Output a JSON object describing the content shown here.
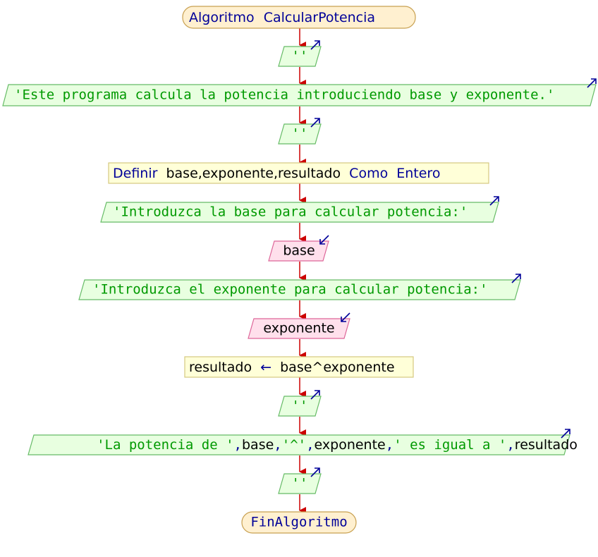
{
  "colors": {
    "arrow": "#cc0000",
    "keyword": "#000099",
    "string": "#009900",
    "text": "#000000",
    "terminal_fill": "#fff0d0",
    "terminal_stroke": "#c8a050",
    "output_fill": "#e8ffe0",
    "output_stroke": "#66bb66",
    "input_fill": "#ffe0ec",
    "input_stroke": "#dd6699",
    "process_fill": "#ffffd8",
    "process_stroke": "#d4c880"
  },
  "flowchart": {
    "start": {
      "keyword": "Algoritmo",
      "name": "CalcularPotencia"
    },
    "output_1": {
      "text": "''"
    },
    "output_2": {
      "text": "'Este programa calcula la potencia introduciendo base y exponente.'"
    },
    "output_3": {
      "text": "''"
    },
    "define": {
      "kw_define": "Definir",
      "vars": "base,exponente,resultado",
      "kw_as": "Como",
      "type": "Entero"
    },
    "output_4": {
      "text": "'Introduzca la base para calcular potencia:'"
    },
    "input_1": {
      "var": "base"
    },
    "output_5": {
      "text": "'Introduzca el exponente para calcular potencia:'"
    },
    "input_2": {
      "var": "exponente"
    },
    "assign": {
      "target": "resultado",
      "arrow": "←",
      "expr": "base^exponente"
    },
    "output_6": {
      "text": "''"
    },
    "output_7": {
      "s1": "'La potencia de '",
      "c1": ",",
      "v1": "base",
      "c2": ",",
      "s2": "'^'",
      "c3": ",",
      "v2": "exponente",
      "c4": ",",
      "s3": "' es igual a '",
      "c5": ",",
      "v3": "resultado"
    },
    "output_8": {
      "text": "''"
    },
    "end": {
      "keyword": "FinAlgoritmo"
    }
  }
}
